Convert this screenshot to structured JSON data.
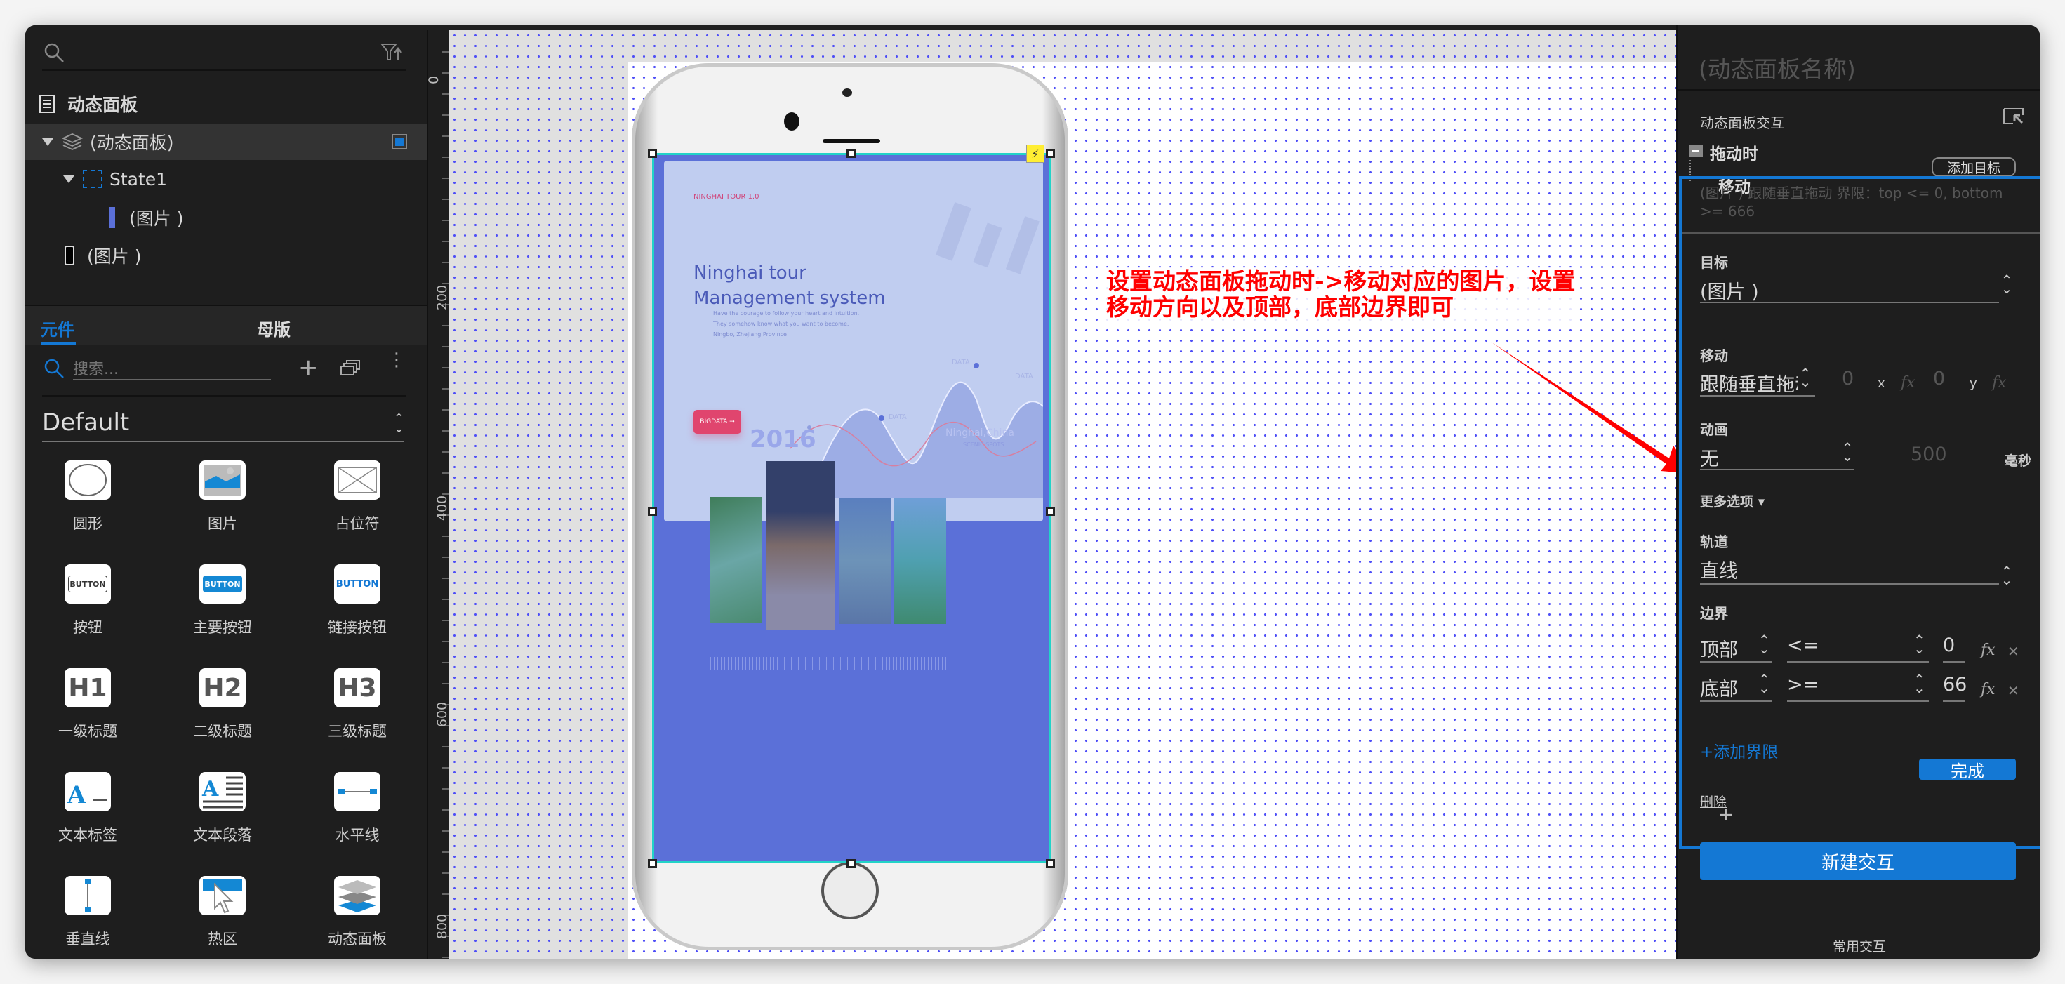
{
  "left_panel": {
    "outline": {
      "page_title": "动态面板",
      "items": [
        {
          "label": "(动态面板)",
          "icon": "layers-icon"
        },
        {
          "label": "State1",
          "icon": "state-icon"
        },
        {
          "label": "(图片 )",
          "icon": "image-thumb-icon"
        },
        {
          "label": "(图片 )",
          "icon": "phone-thumb-icon"
        }
      ]
    },
    "tabs": [
      {
        "label": "元件",
        "active": true
      },
      {
        "label": "母版",
        "active": false
      }
    ],
    "search_placeholder": "搜索...",
    "library": "Default",
    "widgets": [
      {
        "label": "圆形",
        "icon": "circle"
      },
      {
        "label": "图片",
        "icon": "image"
      },
      {
        "label": "占位符",
        "icon": "placeholder"
      },
      {
        "label": "按钮",
        "icon": "button",
        "text": "BUTTON"
      },
      {
        "label": "主要按钮",
        "icon": "primary-button",
        "text": "BUTTON"
      },
      {
        "label": "链接按钮",
        "icon": "link-button",
        "text": "BUTTON"
      },
      {
        "label": "一级标题",
        "icon": "h1",
        "text": "H1"
      },
      {
        "label": "二级标题",
        "icon": "h2",
        "text": "H2"
      },
      {
        "label": "三级标题",
        "icon": "h3",
        "text": "H3"
      },
      {
        "label": "文本标签",
        "icon": "text-label"
      },
      {
        "label": "文本段落",
        "icon": "text-paragraph"
      },
      {
        "label": "水平线",
        "icon": "horizontal-line"
      },
      {
        "label": "垂直线",
        "icon": "vertical-line"
      },
      {
        "label": "热区",
        "icon": "hotspot"
      },
      {
        "label": "动态面板",
        "icon": "dynamic-panel"
      }
    ]
  },
  "ruler": {
    "labels": [
      "0",
      "200",
      "400",
      "600",
      "800"
    ]
  },
  "canvas": {
    "annotation_line1": "设置动态面板拖动时->移动对应的图片，设置",
    "annotation_line2": "移动方向以及顶部，底部边界即可",
    "annotation_color": "#ff0000",
    "screen": {
      "tag": "NINGHAI TOUR 1.0",
      "title1": "Ninghai tour",
      "title2": "Management system",
      "desc1": "Have the courage to follow your heart and intuition.",
      "desc2": "They somehow know what you want to become.",
      "desc3": "Ningbo, Zhejiang Province",
      "button": "BIGDATA",
      "data_labels": [
        "DATA",
        "DATA",
        "DATA"
      ],
      "year": "2016",
      "location": "Ninghai,China",
      "location_sub": "SCENIC SPOTS"
    }
  },
  "right_panel": {
    "title": "(动态面板名称)",
    "section": "动态面板交互",
    "event": "拖动时",
    "action": "移动",
    "add_target": "添加目标",
    "summary": "(图片 ) 跟随垂直拖动 界限：top <= 0, bottom >= 666",
    "target_label": "目标",
    "target_value": "(图片 )",
    "move_label": "移动",
    "move_value": "跟随垂直拖动",
    "x_value": "0",
    "x_label": "x",
    "y_value": "0",
    "y_label": "y",
    "fx": "fx",
    "anim_label": "动画",
    "anim_value": "无",
    "anim_duration": "500",
    "anim_unit": "毫秒",
    "more_options": "更多选项",
    "track_label": "轨道",
    "track_value": "直线",
    "bounds_label": "边界",
    "bounds": [
      {
        "side": "顶部",
        "op": "<=",
        "value": "0"
      },
      {
        "side": "底部",
        "op": ">=",
        "value": "66"
      }
    ],
    "add_bound": "+添加界限",
    "delete": "删除",
    "done": "完成",
    "plus": "+",
    "new_interaction": "新建交互",
    "common": "常用交互",
    "accent": "#1478d4"
  }
}
